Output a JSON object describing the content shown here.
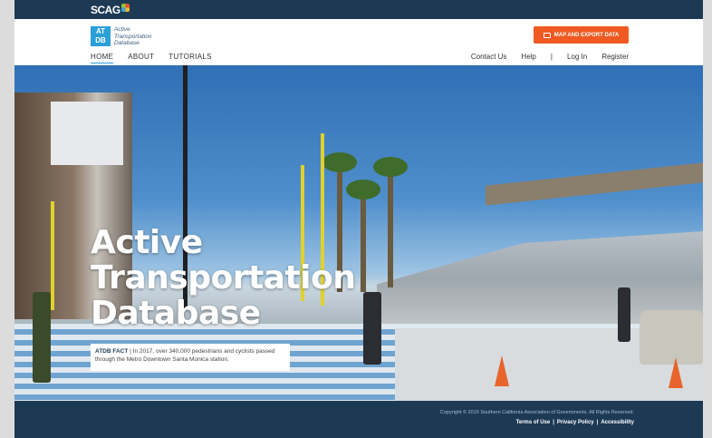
{
  "topbar": {
    "logo_text": "SCAG"
  },
  "header": {
    "logo_abbr_line1": "AT",
    "logo_abbr_line2": "DB",
    "logo_title_line1": "Active",
    "logo_title_line2": "Transportation",
    "logo_title_line3": "Database",
    "cta_label": "MAP AND EXPORT DATA"
  },
  "nav": {
    "left": [
      {
        "label": "HOME"
      },
      {
        "label": "ABOUT"
      },
      {
        "label": "TUTORIALS"
      }
    ],
    "right": {
      "contact": "Contact Us",
      "help": "Help",
      "separator": "|",
      "login": "Log In",
      "register": "Register"
    }
  },
  "hero": {
    "title_line1": "Active",
    "title_line2": "Transportation",
    "title_line3": "Database",
    "fact_label": "ATDB FACT",
    "fact_sep": "|",
    "fact_text": "In 2017, over 340,000 pedestrians and cyclists passed through the Metro Downtown Santa Monica station."
  },
  "footer": {
    "copyright": "Copyright © 2015 Southern California Association of Governments. All Rights Reserved.",
    "links": [
      {
        "label": "Terms of Use"
      },
      {
        "label": "Privacy Policy"
      },
      {
        "label": "Accessibility"
      }
    ],
    "link_sep": "|"
  },
  "colors": {
    "brand_navy": "#1d3a55",
    "accent_blue": "#2a9fd8",
    "cta_orange": "#f05a22"
  },
  "icons": [
    "map-icon"
  ]
}
